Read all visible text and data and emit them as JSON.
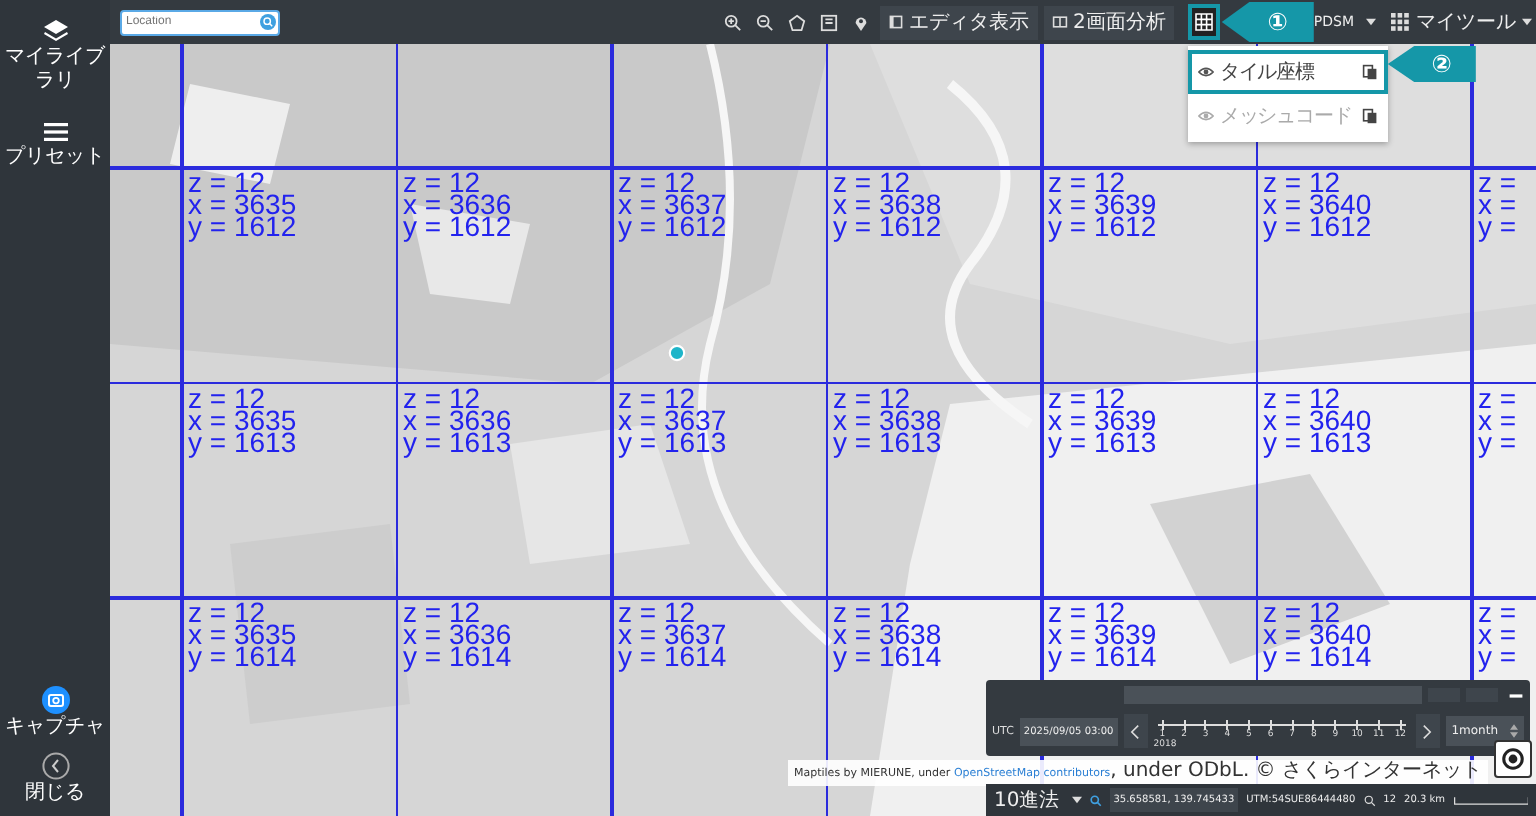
{
  "sidebar": {
    "items": [
      {
        "label": "マイライブラリ",
        "kind": "layers"
      },
      {
        "label": "プリセット",
        "kind": "list"
      }
    ],
    "bottom": [
      {
        "label": "キャプチャ",
        "kind": "capture"
      },
      {
        "label": "閉じる",
        "kind": "close"
      }
    ]
  },
  "search": {
    "placeholder": "Location"
  },
  "toolbar": {
    "buttons": [
      {
        "label": "エディタ表示",
        "kind": "editor"
      },
      {
        "label": "2画面分析",
        "kind": "split"
      }
    ],
    "basemap": "PDSM",
    "mytools": "マイツール"
  },
  "tile_menu": {
    "items": [
      {
        "label": "タイル座標",
        "selected": true
      },
      {
        "label": "メッシュコード",
        "selected": false
      }
    ]
  },
  "callouts": [
    "①",
    "②"
  ],
  "tile_grid": {
    "rows": [
      [
        [
          "z = 12",
          "x = 3635",
          "y = 1612"
        ],
        [
          "z = 12",
          "x = 3636",
          "y = 1612"
        ],
        [
          "z = 12",
          "x = 3637",
          "y = 1612"
        ],
        [
          "z = 12",
          "x = 3638",
          "y = 1612"
        ],
        [
          "z = 12",
          "x = 3639",
          "y = 1612"
        ],
        [
          "z = 12",
          "x = 3640",
          "y = 1612"
        ],
        [
          "z =",
          "x =",
          "y ="
        ]
      ],
      [
        [
          "z = 12",
          "x = 3635",
          "y = 1613"
        ],
        [
          "z = 12",
          "x = 3636",
          "y = 1613"
        ],
        [
          "z = 12",
          "x = 3637",
          "y = 1613"
        ],
        [
          "z = 12",
          "x = 3638",
          "y = 1613"
        ],
        [
          "z = 12",
          "x = 3639",
          "y = 1613"
        ],
        [
          "z = 12",
          "x = 3640",
          "y = 1613"
        ],
        [
          "z =",
          "x =",
          "y ="
        ]
      ],
      [
        [
          "z = 12",
          "x = 3635",
          "y = 1614"
        ],
        [
          "z = 12",
          "x = 3636",
          "y = 1614"
        ],
        [
          "z = 12",
          "x = 3637",
          "y = 1614"
        ],
        [
          "z = 12",
          "x = 3638",
          "y = 1614"
        ],
        [
          "z = 12",
          "x = 3639",
          "y = 1614"
        ],
        [
          "z = 12",
          "x = 3640",
          "y = 1614"
        ],
        [
          "z =",
          "x =",
          "y ="
        ]
      ]
    ]
  },
  "timeline": {
    "utc_label": "UTC",
    "datetime": "2025/09/05 03:00",
    "year": "2018",
    "ticks": [
      "1",
      "2",
      "3",
      "4",
      "5",
      "6",
      "7",
      "8",
      "9",
      "10",
      "11",
      "12"
    ],
    "interval": "1month"
  },
  "attribution": {
    "before": "Maptiles by MIERUNE, under ",
    "link": "OpenStreetMap contributors",
    "after": ", under ODbL. © さくらインターネット"
  },
  "status_bar": {
    "format": "10進法",
    "coordinates": "35.658581, 139.745433",
    "utm": "UTM:54SUE86444480",
    "zoom": "12",
    "scale": "20.3 km"
  }
}
